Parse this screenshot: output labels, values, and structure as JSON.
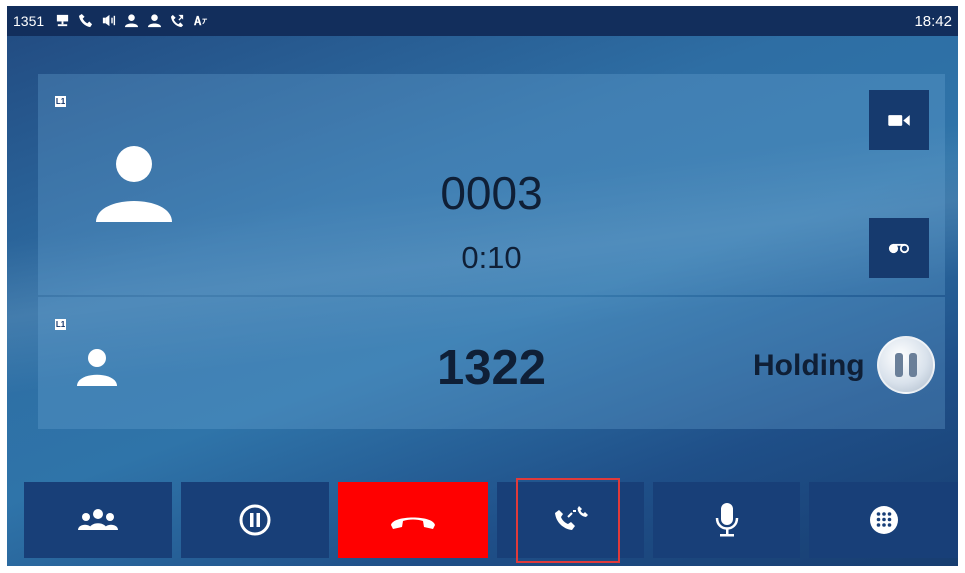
{
  "status_bar": {
    "extension": "1351",
    "time": "18:42",
    "icons": [
      "network-icon",
      "phone-icon",
      "speaker-icon",
      "contact-icon",
      "contact-icon",
      "call-forward-icon",
      "language-icon"
    ]
  },
  "active_call": {
    "line": "L1",
    "number": "0003",
    "duration": "0:10"
  },
  "held_call": {
    "line": "L1",
    "number": "1322",
    "status": "Holding"
  },
  "softkeys": [
    "conference-icon",
    "hold-icon",
    "end-call-icon",
    "transfer-icon",
    "mute-icon",
    "keypad-icon"
  ],
  "colors": {
    "end_call": "#ff0000",
    "softkey": "#183f78",
    "highlight": "#e03a3a",
    "status_bar": "#122e5c"
  }
}
